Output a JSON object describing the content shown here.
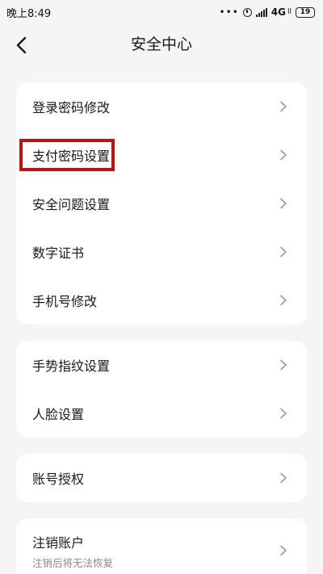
{
  "status_bar": {
    "time": "晚上8:49",
    "network": "4G",
    "network_sub": "ll",
    "battery": "19",
    "icons": [
      "more-dots-icon",
      "alarm-icon",
      "signal-icon",
      "battery-icon"
    ]
  },
  "header": {
    "title": "安全中心",
    "back_icon": "chevron-left-icon"
  },
  "groups": [
    {
      "items": [
        {
          "label": "登录密码修改"
        },
        {
          "label": "支付密码设置",
          "highlighted": true
        },
        {
          "label": "安全问题设置"
        },
        {
          "label": "数字证书"
        },
        {
          "label": "手机号修改"
        }
      ]
    },
    {
      "items": [
        {
          "label": "手势指纹设置"
        },
        {
          "label": "人脸设置"
        }
      ]
    },
    {
      "items": [
        {
          "label": "账号授权"
        }
      ]
    },
    {
      "items": [
        {
          "label": "注销账户",
          "sublabel": "注销后将无法恢复"
        }
      ]
    }
  ],
  "colors": {
    "background": "#f5f5f5",
    "card": "#ffffff",
    "highlight": "#c20f0f",
    "chevron": "#9a9a9a"
  }
}
